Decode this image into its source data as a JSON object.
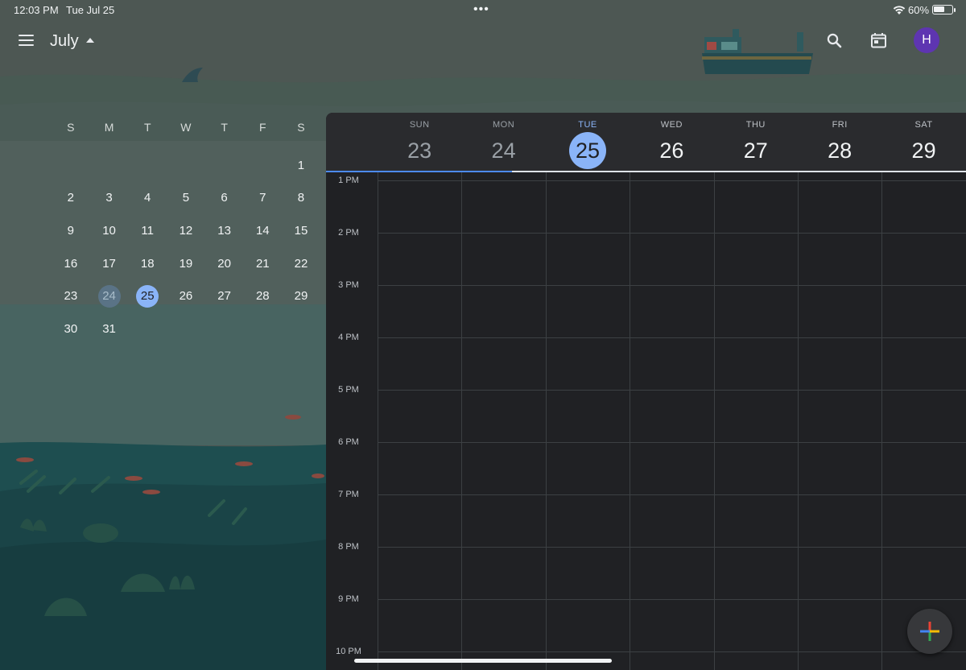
{
  "status": {
    "time": "12:03 PM",
    "date": "Tue Jul 25",
    "dots": "•••",
    "battery": "60%",
    "battery_level": 0.6
  },
  "header": {
    "menu_icon": "hamburger-menu-icon",
    "month": "July",
    "search_icon": "search-icon",
    "today_icon": "calendar-today-icon",
    "avatar_initial": "H",
    "avatar_color": "#5e35b1"
  },
  "mini_calendar": {
    "weekdays": [
      "S",
      "M",
      "T",
      "W",
      "T",
      "F",
      "S"
    ],
    "weeks": [
      [
        "",
        "",
        "",
        "",
        "",
        "",
        "1"
      ],
      [
        "2",
        "3",
        "4",
        "5",
        "6",
        "7",
        "8"
      ],
      [
        "9",
        "10",
        "11",
        "12",
        "13",
        "14",
        "15"
      ],
      [
        "16",
        "17",
        "18",
        "19",
        "20",
        "21",
        "22"
      ],
      [
        "23",
        "24",
        "25",
        "26",
        "27",
        "28",
        "29"
      ],
      [
        "30",
        "31",
        "",
        "",
        "",
        "",
        ""
      ]
    ],
    "today": "25",
    "selected": "24"
  },
  "week_view": {
    "days": [
      {
        "dow": "SUN",
        "num": "23",
        "state": "past"
      },
      {
        "dow": "MON",
        "num": "24",
        "state": "past"
      },
      {
        "dow": "TUE",
        "num": "25",
        "state": "today"
      },
      {
        "dow": "WED",
        "num": "26",
        "state": "future"
      },
      {
        "dow": "THU",
        "num": "27",
        "state": "future"
      },
      {
        "dow": "FRI",
        "num": "28",
        "state": "future"
      },
      {
        "dow": "SAT",
        "num": "29",
        "state": "future"
      }
    ],
    "hours": [
      "1 PM",
      "2 PM",
      "3 PM",
      "4 PM",
      "5 PM",
      "6 PM",
      "7 PM",
      "8 PM",
      "9 PM",
      "10 PM"
    ]
  },
  "fab": {
    "icon": "plus-icon"
  },
  "colors": {
    "accent": "#8ab4f8",
    "progress": "#4c8bf5",
    "panel": "#202124"
  }
}
